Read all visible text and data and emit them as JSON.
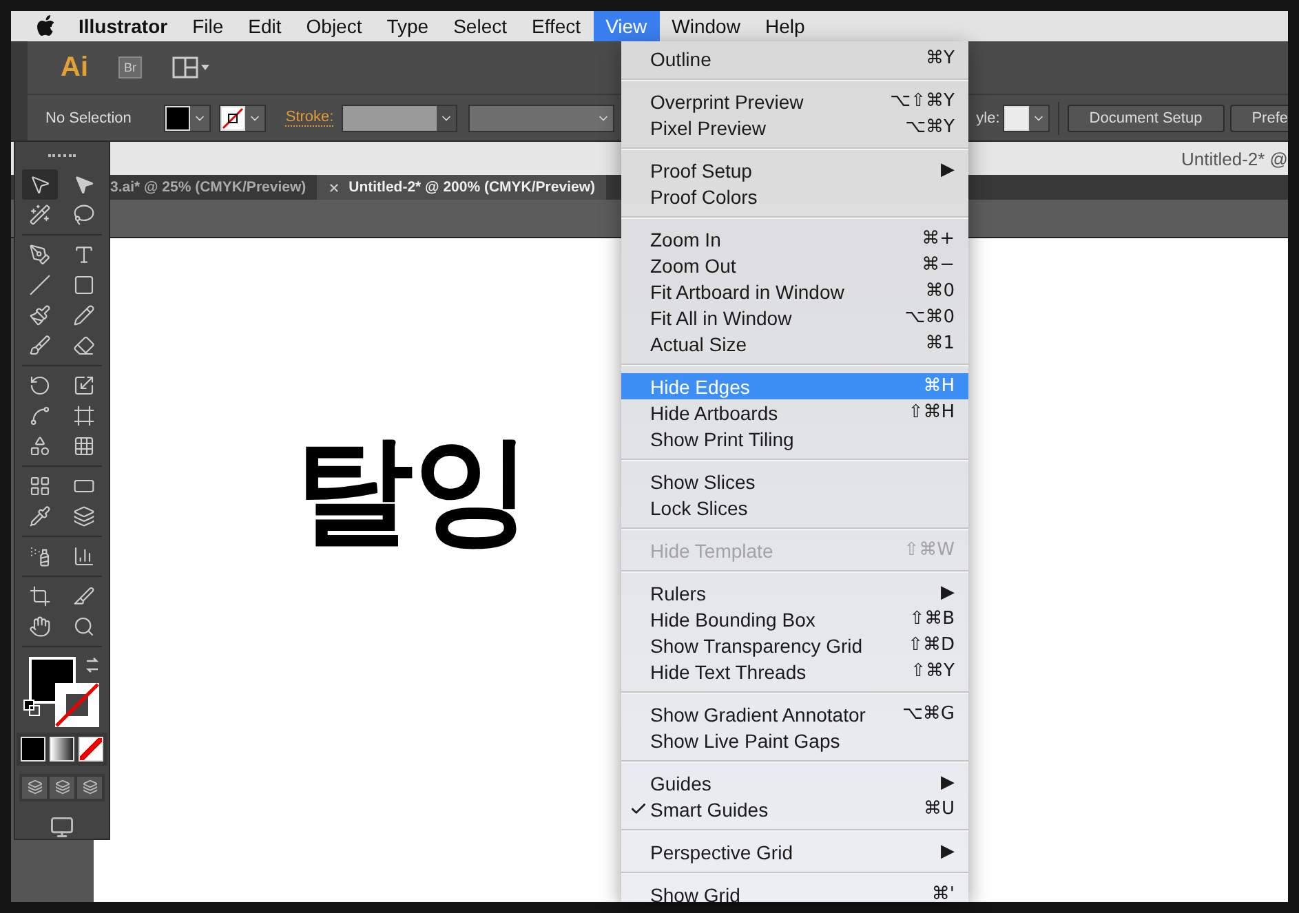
{
  "menubar": {
    "items": [
      {
        "label": "Illustrator",
        "kind": "app",
        "selected": false
      },
      {
        "label": "File",
        "kind": "menu",
        "selected": false
      },
      {
        "label": "Edit",
        "kind": "menu",
        "selected": false
      },
      {
        "label": "Object",
        "kind": "menu",
        "selected": false
      },
      {
        "label": "Type",
        "kind": "menu",
        "selected": false
      },
      {
        "label": "Select",
        "kind": "menu",
        "selected": false
      },
      {
        "label": "Effect",
        "kind": "menu",
        "selected": false
      },
      {
        "label": "View",
        "kind": "menu",
        "selected": true
      },
      {
        "label": "Window",
        "kind": "menu",
        "selected": false
      },
      {
        "label": "Help",
        "kind": "menu",
        "selected": false
      }
    ]
  },
  "app_bar": {
    "logo": "Ai",
    "bridge_badge": "Br"
  },
  "control_bar": {
    "selection": "No Selection",
    "stroke_label": "Stroke:",
    "style_label": "yle:",
    "buttons": [
      "Document Setup",
      "Prefe"
    ]
  },
  "title_bar": {
    "title": "Untitled-2* @"
  },
  "tabs": [
    {
      "label": "3.ai* @ 25% (CMYK/Preview)",
      "selected": false,
      "closable": false
    },
    {
      "label": "Untitled-2* @ 200% (CMYK/Preview)",
      "selected": true,
      "closable": true
    }
  ],
  "canvas": {
    "text": "탈잉"
  },
  "view_menu": {
    "groups": [
      {
        "items": [
          {
            "label": "Outline",
            "shortcut": "⌘Y",
            "selected": false,
            "disabled": false,
            "checked": false
          }
        ]
      },
      {
        "items": [
          {
            "label": "Overprint Preview",
            "shortcut": "⌥⇧⌘Y",
            "selected": false,
            "disabled": false,
            "checked": false
          },
          {
            "label": "Pixel Preview",
            "shortcut": "⌥⌘Y",
            "selected": false,
            "disabled": false,
            "checked": false
          }
        ]
      },
      {
        "items": [
          {
            "label": "Proof Setup",
            "shortcut": "▶",
            "selected": false,
            "disabled": false,
            "checked": false
          },
          {
            "label": "Proof Colors",
            "selected": false,
            "disabled": false,
            "checked": false
          }
        ]
      },
      {
        "items": [
          {
            "label": "Zoom In",
            "shortcut": "⌘+",
            "selected": false,
            "disabled": false,
            "checked": false
          },
          {
            "label": "Zoom Out",
            "shortcut": "⌘−",
            "selected": false,
            "disabled": false,
            "checked": false
          },
          {
            "label": "Fit Artboard in Window",
            "shortcut": "⌘0",
            "selected": false,
            "disabled": false,
            "checked": false
          },
          {
            "label": "Fit All in Window",
            "shortcut": "⌥⌘0",
            "selected": false,
            "disabled": false,
            "checked": false
          },
          {
            "label": "Actual Size",
            "shortcut": "⌘1",
            "selected": false,
            "disabled": false,
            "checked": false
          }
        ]
      },
      {
        "items": [
          {
            "label": "Hide Edges",
            "shortcut": "⌘H",
            "selected": true,
            "disabled": false,
            "checked": false
          },
          {
            "label": "Hide Artboards",
            "shortcut": "⇧⌘H",
            "selected": false,
            "disabled": false,
            "checked": false
          },
          {
            "label": "Show Print Tiling",
            "selected": false,
            "disabled": false,
            "checked": false
          }
        ]
      },
      {
        "items": [
          {
            "label": "Show Slices",
            "selected": false,
            "disabled": false,
            "checked": false
          },
          {
            "label": "Lock Slices",
            "selected": false,
            "disabled": false,
            "checked": false
          }
        ]
      },
      {
        "items": [
          {
            "label": "Hide Template",
            "shortcut": "⇧⌘W",
            "selected": false,
            "disabled": true,
            "checked": false
          }
        ]
      },
      {
        "items": [
          {
            "label": "Rulers",
            "shortcut": "▶",
            "selected": false,
            "disabled": false,
            "checked": false
          },
          {
            "label": "Hide Bounding Box",
            "shortcut": "⇧⌘B",
            "selected": false,
            "disabled": false,
            "checked": false
          },
          {
            "label": "Show Transparency Grid",
            "shortcut": "⇧⌘D",
            "selected": false,
            "disabled": false,
            "checked": false
          },
          {
            "label": "Hide Text Threads",
            "shortcut": "⇧⌘Y",
            "selected": false,
            "disabled": false,
            "checked": false
          }
        ]
      },
      {
        "items": [
          {
            "label": "Show Gradient Annotator",
            "shortcut": "⌥⌘G",
            "selected": false,
            "disabled": false,
            "checked": false
          },
          {
            "label": "Show Live Paint Gaps",
            "selected": false,
            "disabled": false,
            "checked": false
          }
        ]
      },
      {
        "items": [
          {
            "label": "Guides",
            "shortcut": "▶",
            "selected": false,
            "disabled": false,
            "checked": false
          },
          {
            "label": "Smart Guides",
            "shortcut": "⌘U",
            "selected": false,
            "disabled": false,
            "checked": true
          }
        ]
      },
      {
        "items": [
          {
            "label": "Perspective Grid",
            "shortcut": "▶",
            "selected": false,
            "disabled": false,
            "checked": false
          }
        ]
      },
      {
        "items": [
          {
            "label": "Show Grid",
            "shortcut": "⌘'",
            "selected": false,
            "disabled": false,
            "checked": false
          }
        ]
      }
    ]
  }
}
